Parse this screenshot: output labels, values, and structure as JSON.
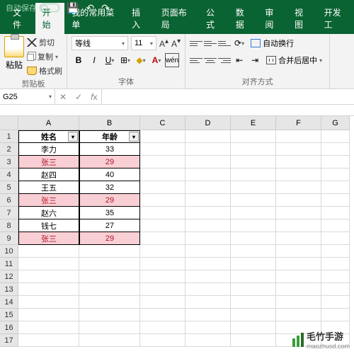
{
  "titlebar": {
    "autosave": "自动保存"
  },
  "tabs": [
    "文件",
    "开始",
    "我的常用菜单",
    "插入",
    "页面布局",
    "公式",
    "数据",
    "审阅",
    "视图",
    "开发工"
  ],
  "active_tab": 1,
  "ribbon": {
    "clipboard": {
      "paste": "粘贴",
      "cut": "剪切",
      "copy": "复制",
      "format_painter": "格式刷",
      "label": "剪贴板"
    },
    "font": {
      "name": "等线",
      "size": "11",
      "label": "字体",
      "btns": {
        "bold": "B",
        "italic": "I",
        "underline": "U",
        "wen": "wén"
      }
    },
    "align": {
      "wrap": "自动换行",
      "merge": "合并后居中",
      "label": "对齐方式"
    }
  },
  "namebox": "G25",
  "formula": "",
  "columns": [
    "A",
    "B",
    "C",
    "D",
    "E",
    "F",
    "G"
  ],
  "rows": [
    "1",
    "2",
    "3",
    "4",
    "5",
    "6",
    "7",
    "8",
    "9",
    "10",
    "11",
    "12",
    "13",
    "14",
    "15",
    "16",
    "17"
  ],
  "chart_data": {
    "type": "table",
    "title": "",
    "headers": [
      "姓名",
      "年龄"
    ],
    "records": [
      {
        "name": "李力",
        "age": 33,
        "highlight": false
      },
      {
        "name": "张三",
        "age": 29,
        "highlight": true
      },
      {
        "name": "赵四",
        "age": 40,
        "highlight": false
      },
      {
        "name": "王五",
        "age": 32,
        "highlight": false
      },
      {
        "name": "张三",
        "age": 29,
        "highlight": true
      },
      {
        "name": "赵六",
        "age": 35,
        "highlight": false
      },
      {
        "name": "钱七",
        "age": 27,
        "highlight": false
      },
      {
        "name": "张三",
        "age": 29,
        "highlight": true
      }
    ]
  },
  "watermark": {
    "name": "毛竹手游",
    "url": "maozhusd.com"
  }
}
